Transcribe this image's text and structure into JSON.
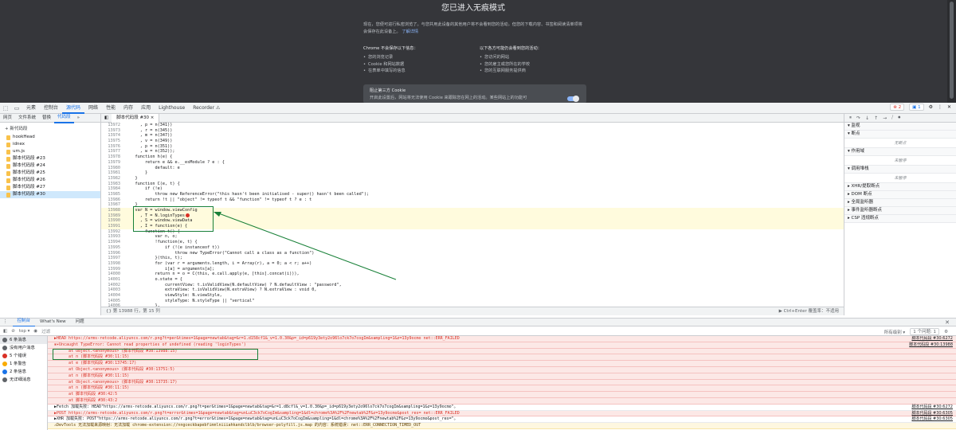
{
  "incognito": {
    "title": "您已进入无痕模式",
    "desc": "现在，您便可进行私密浏览了。与您共用此设备的其他用户将不会看到您的活动，但您的下载内容、书签和阅读清单项将会保存在此设备上。",
    "learn_more": "了解详情",
    "col1_head": "Chrome 不会保存以下信息：",
    "col1": [
      "您的浏览记录",
      "Cookie 和网站数据",
      "在表单中填写的信息"
    ],
    "col2_head": "以下各方可能仍会看到您的活动：",
    "col2": [
      "您访问的网站",
      "您的雇主或您所在的学校",
      "您的互联网服务提供商"
    ],
    "cookie_title": "阻止第三方 Cookie",
    "cookie_desc": "开启此设置后，网站将无法使用 Cookie 来跟踪您在网上的活动。某些网站上的功能可"
  },
  "devtools": {
    "tabs": [
      "元素",
      "控制台",
      "源代码",
      "网络",
      "性能",
      "内存",
      "应用",
      "Lighthouse",
      "Recorder ⚠"
    ],
    "active_tab": "源代码",
    "err_badge": "2",
    "info_badge": "1"
  },
  "nav": {
    "tabs": [
      "网页",
      "文件系统",
      "替换",
      "代码段",
      "»"
    ],
    "new_snippet": "+ 新代码段",
    "files": [
      "hookHead",
      "idnex",
      "um.js",
      "脚本代码段 #23",
      "脚本代码段 #24",
      "脚本代码段 #25",
      "脚本代码段 #26",
      "脚本代码段 #27",
      "脚本代码段 #30"
    ]
  },
  "editor": {
    "file_tab": "脚本代码段 #30 ×",
    "lines": [
      {
        "n": "13972",
        "t": "      , p = n(341))"
      },
      {
        "n": "13973",
        "t": "      , r = n(345))"
      },
      {
        "n": "13974",
        "t": "      , m = n(347))"
      },
      {
        "n": "13975",
        "t": "      , v = n(349))"
      },
      {
        "n": "13976",
        "t": "      , p = n(351))"
      },
      {
        "n": "13977",
        "t": "      , w = n(352));"
      },
      {
        "n": "13978",
        "t": "    function h(e) {"
      },
      {
        "n": "13979",
        "t": "        return e && e.__esModule ? e : {"
      },
      {
        "n": "13980",
        "t": "            default: e"
      },
      {
        "n": "13981",
        "t": "        }"
      },
      {
        "n": "13982",
        "t": "    }"
      },
      {
        "n": "13983",
        "t": "    function C(e, t) {"
      },
      {
        "n": "13984",
        "t": "        if (!e)"
      },
      {
        "n": "13985",
        "t": "            throw new ReferenceError(\"this hasn't been initialised - super() hasn't been called\");"
      },
      {
        "n": "13986",
        "t": "        return !t || \"object\" != typeof t && \"function\" != typeof t ? e : t"
      },
      {
        "n": "13987",
        "t": "    }"
      },
      {
        "n": "13988",
        "t": "    var N = window.viewConfig"
      },
      {
        "n": "13989",
        "t": "      , T = N.loginTypes"
      },
      {
        "n": "13990",
        "t": "      , S = window.viewData"
      },
      {
        "n": "13991",
        "t": "      , I = function(e) {"
      },
      {
        "n": "13992",
        "t": "        function t() {"
      },
      {
        "n": "13993",
        "t": "            var n, o;"
      },
      {
        "n": "13994",
        "t": "            !function(e, t) {"
      },
      {
        "n": "13995",
        "t": "                if (!(e instanceof t))"
      },
      {
        "n": "13996",
        "t": "                    throw new TypeError(\"Cannot call a class as a function\")"
      },
      {
        "n": "13997",
        "t": "            }(this, t);"
      },
      {
        "n": "13998",
        "t": "            for (var r = arguments.length, i = Array(r), a = 0; a < r; a++)"
      },
      {
        "n": "13999",
        "t": "                i[a] = arguments[a];"
      },
      {
        "n": "14000",
        "t": "            return n = o = C(this, e.call.apply(e, [this].concat(i))),"
      },
      {
        "n": "14001",
        "t": "            o.state = {"
      },
      {
        "n": "14002",
        "t": "                currentView: t.isValidView(N.defaultView) ? N.defaultView : \"password\","
      },
      {
        "n": "14003",
        "t": "                extraView: t.isValidView(N.extraView) ? N.extraView : void 0,"
      },
      {
        "n": "14004",
        "t": "                viewStyle: N.viewStyle,"
      },
      {
        "n": "14005",
        "t": "                styleType: N.styleType || \"vertical\""
      },
      {
        "n": "14006",
        "t": "            },"
      }
    ],
    "status_left": "{}   第 13988 行，第 15 列",
    "status_right": "▶ Ctrl+Enter   覆盖率：不适用"
  },
  "debugger": {
    "sections": [
      {
        "title": "▾ 监视",
        "body": ""
      },
      {
        "title": "▾ 断点",
        "body": "无断点"
      },
      {
        "title": "▾ 作用域",
        "body": "未暂停"
      },
      {
        "title": "▾ 调用堆栈",
        "body": "未暂停"
      },
      {
        "title": "▸ XHR/提取断点",
        "body": ""
      },
      {
        "title": "▸ DOM 断点",
        "body": ""
      },
      {
        "title": "▸ 全局监听器",
        "body": ""
      },
      {
        "title": "▸ 事件监听器断点",
        "body": ""
      },
      {
        "title": "▸ CSP 违规断点",
        "body": ""
      }
    ]
  },
  "drawer": {
    "tabs": [
      "控制台",
      "What's New",
      "问题"
    ],
    "active_tab": "控制台",
    "context": "top ▾",
    "filter_placeholder": "过滤",
    "levels": "所有级别 ▾",
    "issues": "1 个问题: 1"
  },
  "console_side": [
    {
      "label": "6 条消息",
      "color": "#5f6368"
    },
    {
      "label": "没有用户消息",
      "color": "#5f6368"
    },
    {
      "label": "5 个错误",
      "color": "#d93025"
    },
    {
      "label": "1 条警告",
      "color": "#f9ab00"
    },
    {
      "label": "2 条信息",
      "color": "#1a73e8"
    },
    {
      "label": "无详细消息",
      "color": "#5f6368"
    }
  ],
  "console_msgs": [
    {
      "type": "err",
      "text": "▶HEAD https://arms-retcode.aliyuncs.com/r.png?t=per&times=1&page=newtab&tag=&r=1.d158cf1&_v=1.0.30&p=_id=p619y3ety2o96lo7ck7o7cogIm&sampling=1&z=13y9ocmo net::ERR_FAILED",
      "src": "脚本代码段 #30:6272"
    },
    {
      "type": "err",
      "text": "⊗▾Uncaught TypeError: Cannot read properties of undefined (reading 'loginTypes')",
      "src": "脚本代码段 #30:13988"
    },
    {
      "type": "err",
      "text": "      at Object.<anonymous> (脚本代码段 #30:13988:15)",
      "src": ""
    },
    {
      "type": "err",
      "text": "      at n (脚本代码段 #30:11:15)",
      "src": ""
    },
    {
      "type": "err",
      "text": "      at e (脚本代码段 #30:13745:17)",
      "src": ""
    },
    {
      "type": "err",
      "text": "      at Object.<anonymous> (脚本代码段 #30:13751:5)",
      "src": ""
    },
    {
      "type": "err",
      "text": "      at n (脚本代码段 #30:11:15)",
      "src": ""
    },
    {
      "type": "err",
      "text": "      at Object.<anonymous> (脚本代码段 #30:13735:17)",
      "src": ""
    },
    {
      "type": "err",
      "text": "      at n (脚本代码段 #30:11:15)",
      "src": ""
    },
    {
      "type": "err",
      "text": "      at 脚本代码段 #30:42:5",
      "src": ""
    },
    {
      "type": "err",
      "text": "      at 脚本代码段 #30:43:2",
      "src": ""
    },
    {
      "type": "plain",
      "text": "▶Fetch 加载失败: HEAD\"https://arms-retcode.aliyuncs.com/r.png?t=per&times=1&page=newtab&tag=&r=1.d8cfl&_v=1.0.30&p=_id=p619y3ety2o96lo7ck7o7cogIm&sampling=1&z=13y9ocmo\"。",
      "src": "脚本代码段 #30:6272"
    },
    {
      "type": "err",
      "text": "▶POST https://arms-retcode.aliyuncs.com/r.png?t=error&times=1&page=newtab&tag=unLuC3ck7oCogIm&sampling=1&dl=chrome%3A%2F%2Fnewtab%2F&z=13y9ocmo&post_res= net::ERR_FAILED",
      "src": "脚本代码段 #30:6305"
    },
    {
      "type": "plain",
      "text": "▶XHR 加载失败: POST\"https://arms-retcode.aliyuncs.com/r.png?t=error&times=1&page=newtab&tag=unLuC3ck7oCogIm&sampling=1&dl=chrome%3A%2F%2Fnewtab%2F&z=13y9ocmo&post_res=\"。",
      "src": "脚本代码段 #30:6305"
    },
    {
      "type": "warn",
      "text": "⚠DevTools 无法加载来源映射：无法加载 chrome-extension://nngceckbapebfimnlniiiahkandclblb/browser-polyfill.js.map 的内容：系统错误: net::ERR_CONNECTION_TIMED_OUT",
      "src": ""
    }
  ]
}
